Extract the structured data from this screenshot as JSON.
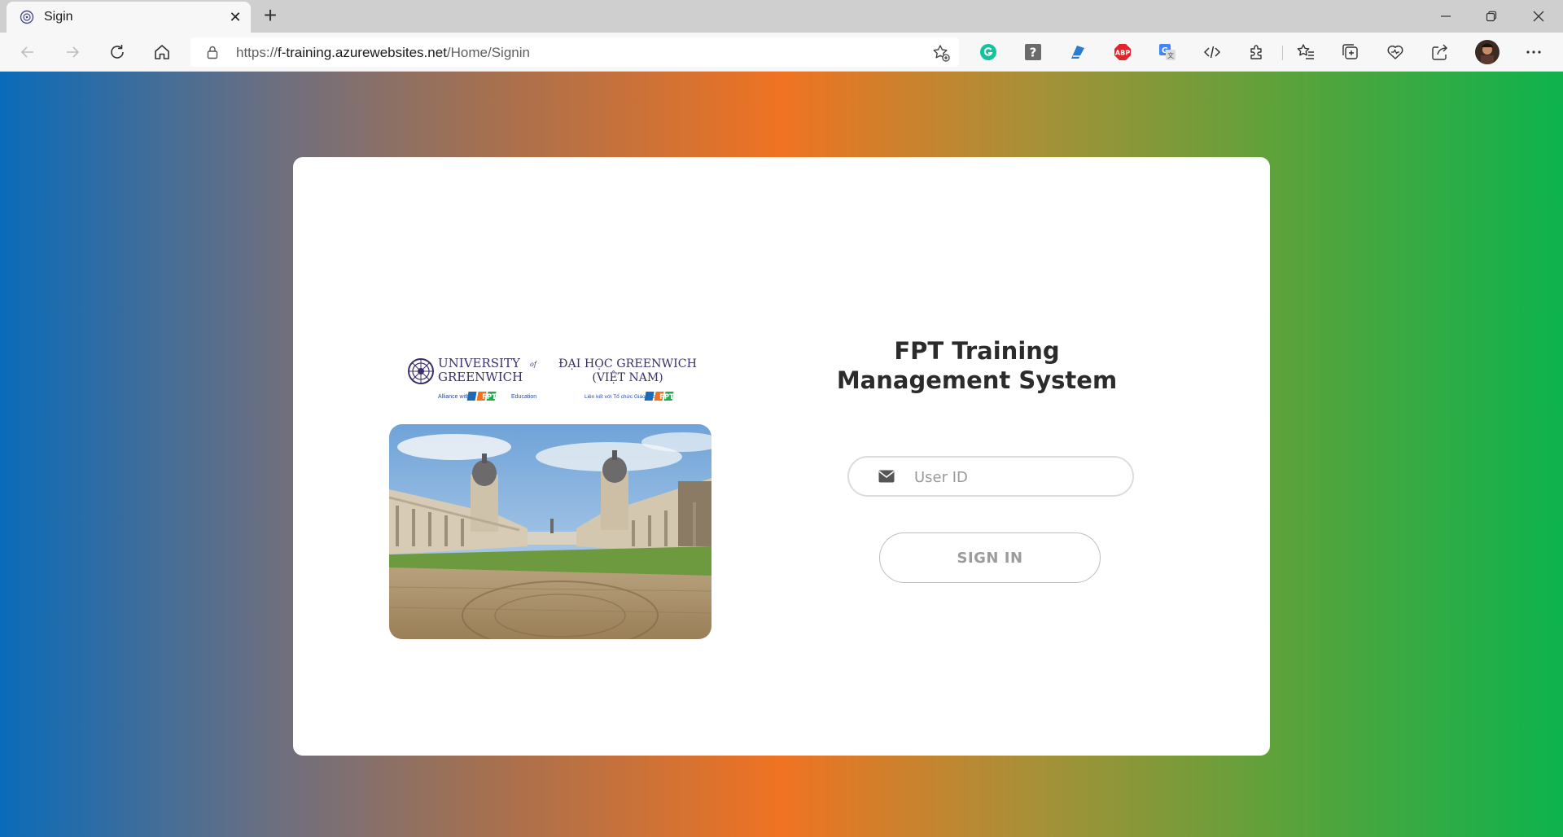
{
  "browser": {
    "tab_title": "Sigin",
    "url_prefix": "https://",
    "url_host": "f-training.azurewebsites.net",
    "url_path": "/Home/Signin",
    "extensions": [
      "grammarly-icon",
      "unknown-extension-icon",
      "pen-extension-icon",
      "adblock-plus-icon",
      "google-translate-icon",
      "dev-tools-icon",
      "extensions-icon"
    ]
  },
  "logos": {
    "uni_line1": "UNIVERSITY",
    "uni_of": "of",
    "uni_line2": "GREENWICH",
    "uni_tag": "Alliance with",
    "uni_tag2": "Education",
    "vn_line1": "ĐẠI HỌC GREENWICH",
    "vn_line2": "(VIỆT NAM)",
    "vn_tag": "Liên kết với Tổ chức Giáo dục",
    "fpt": "FPT"
  },
  "login": {
    "title_line1": "FPT Training",
    "title_line2": "Management System",
    "userid_placeholder": "User ID",
    "signin_label": "SIGN IN"
  },
  "colors": {
    "gradient": [
      "#0a6bb9",
      "#ef7322",
      "#0db34d"
    ]
  }
}
